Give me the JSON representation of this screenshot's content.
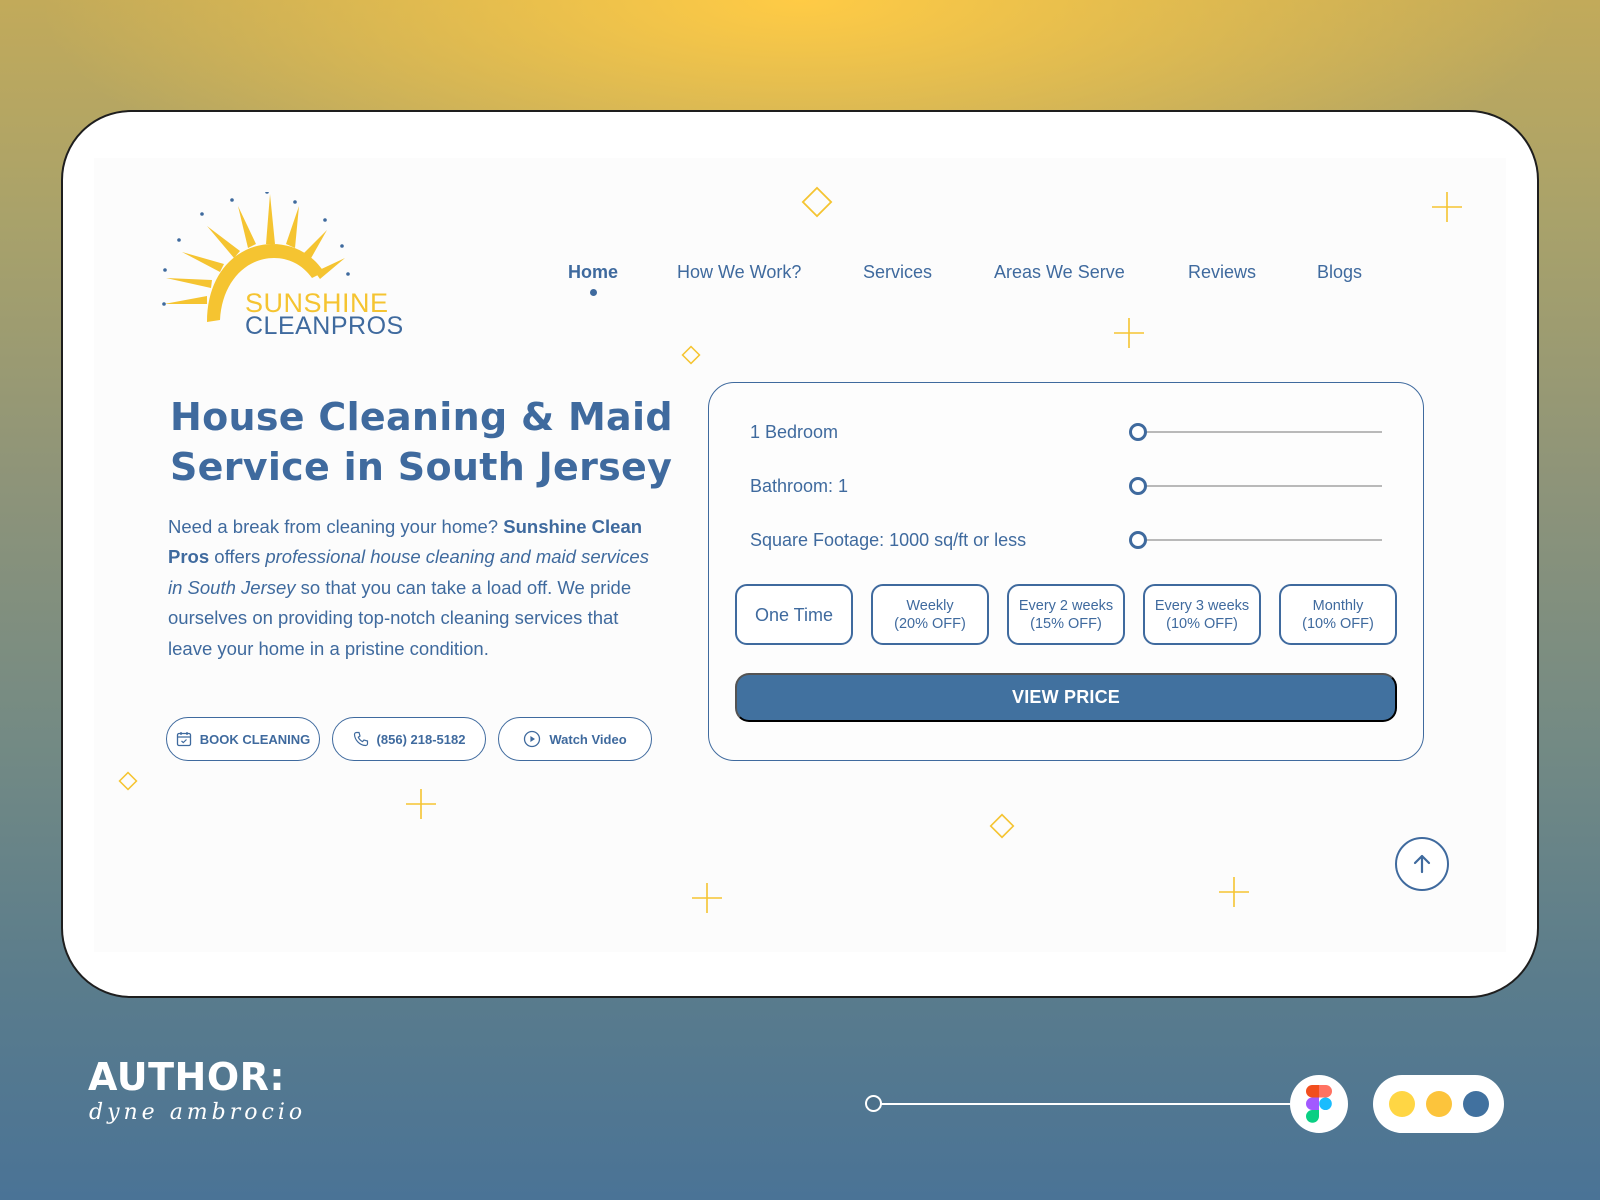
{
  "brand": {
    "line1": "SUNSHINE",
    "line2": "CLEANPROS"
  },
  "nav": {
    "items": [
      {
        "label": "Home",
        "active": true
      },
      {
        "label": "How We Work?"
      },
      {
        "label": "Services"
      },
      {
        "label": "Areas We Serve"
      },
      {
        "label": "Reviews"
      },
      {
        "label": "Blogs"
      }
    ]
  },
  "hero": {
    "title_line1": "House Cleaning & Maid",
    "title_line2": "Service in South Jersey",
    "body": {
      "p1": "Need a break from cleaning your home? ",
      "brand": "Sunshine Clean Pros",
      "p2": " offers ",
      "emph": "professional house cleaning and maid services in South Jersey",
      "p3": " so that you can take a load off. We pride ourselves on providing top-notch cleaning services that leave your home in a pristine condition."
    },
    "buttons": {
      "book": "BOOK CLEANING",
      "phone": "(856) 218-5182",
      "video": "Watch Video"
    }
  },
  "pricing": {
    "sliders": [
      {
        "label": "1 Bedroom",
        "level": 0
      },
      {
        "label": "Bathroom: 1",
        "level": 0
      },
      {
        "label": "Square Footage: 1000 sq/ft or less",
        "level": 0
      }
    ],
    "frequency": [
      {
        "line1": "One Time",
        "line2": ""
      },
      {
        "line1": "Weekly",
        "line2": "(20% OFF)"
      },
      {
        "line1": "Every 2 weeks",
        "line2": "(15% OFF)"
      },
      {
        "line1": "Every 3 weeks",
        "line2": "(10% OFF)"
      },
      {
        "line1": "Monthly",
        "line2": "(10% OFF)"
      }
    ],
    "cta": "VIEW PRICE"
  },
  "footer": {
    "author_label": "AUTHOR:",
    "signature": "dyne ambrocio",
    "swatches": [
      "#ffd644",
      "#fcc43c",
      "#41719f"
    ]
  },
  "colors": {
    "primary": "#41719f",
    "accent": "#f5c431"
  },
  "icons": {
    "book": "calendar-icon",
    "phone": "phone-icon",
    "video": "play-icon",
    "scroll": "arrow-up-icon",
    "figma": "figma-icon"
  }
}
